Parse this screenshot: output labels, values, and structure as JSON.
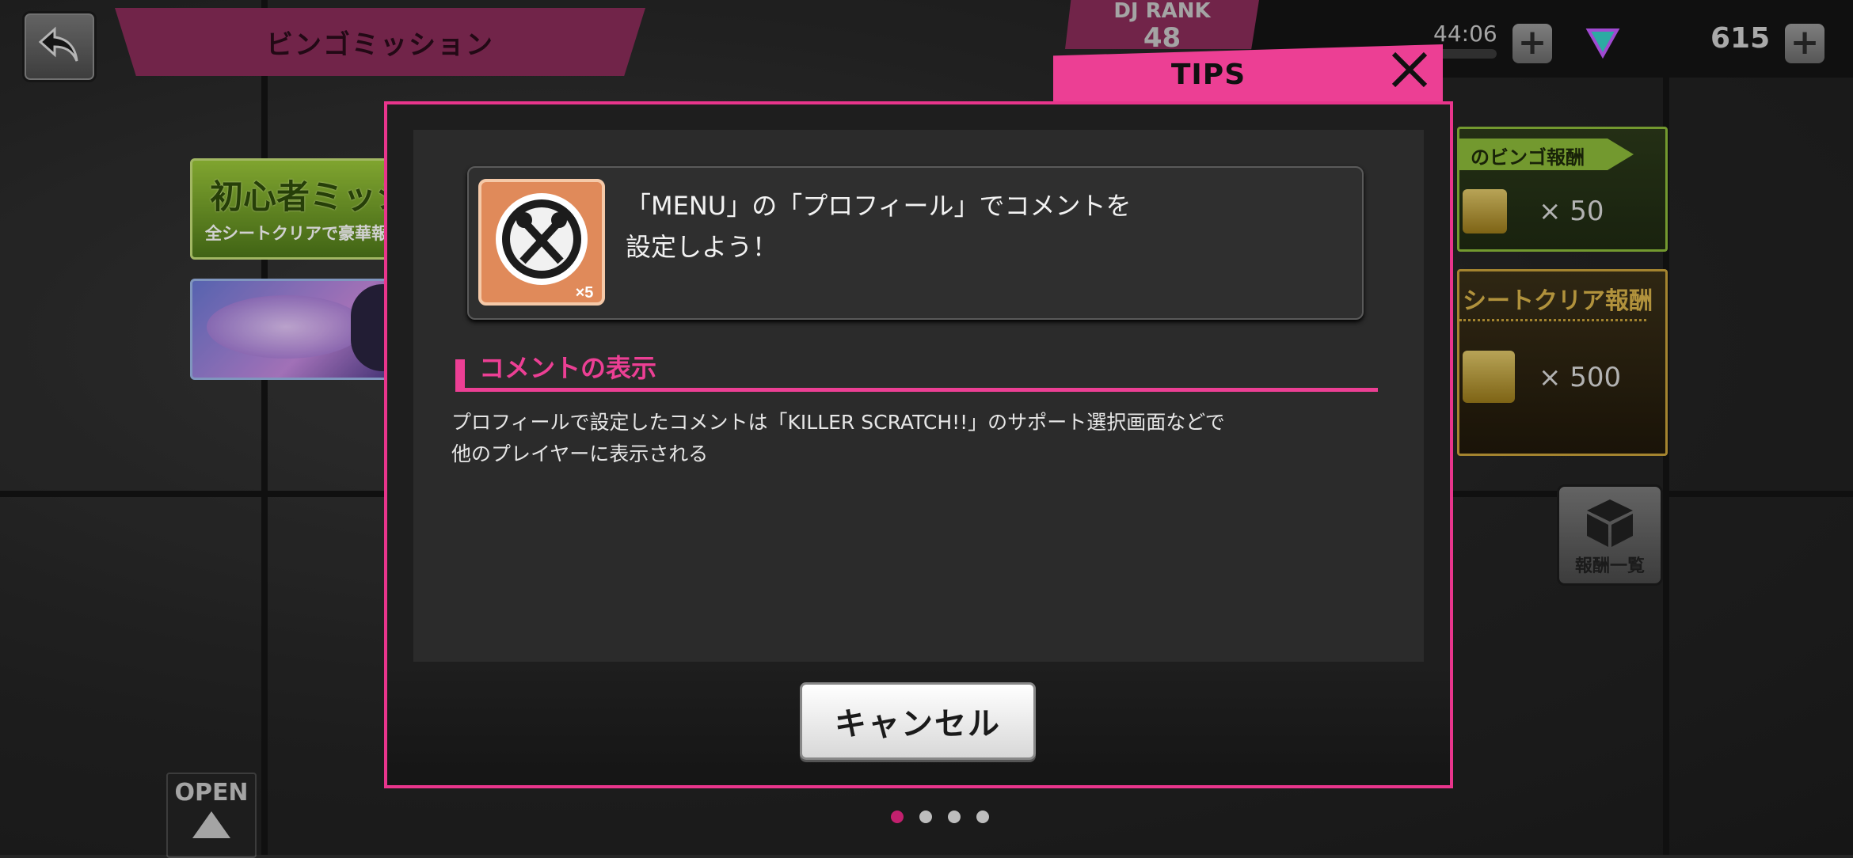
{
  "header": {
    "title": "ビンゴミッション",
    "rank_label": "DJ RANK",
    "rank_value": "48",
    "timer": "44:06",
    "gem_count": "615"
  },
  "events": {
    "beginner_title": "初心者ミッシ",
    "beginner_sub": "全シートクリアで豪華報"
  },
  "rewards": {
    "bingo_label": "のビンゴ報酬",
    "bingo_count": "× 50",
    "sheet_label": "シートクリア報酬",
    "sheet_count": "× 500",
    "list_button": "報酬一覧"
  },
  "open_button": "OPEN",
  "pager": {
    "total": 4,
    "active": 0
  },
  "tips": {
    "tab_label": "TIPS",
    "item_multiplier": "×5",
    "card_text": "「MENU」の「プロフィール」でコメントを\n設定しよう！",
    "section_title": "コメントの表示",
    "body": "プロフィールで設定したコメントは「KILLER SCRATCH!!」のサポート選択画面などで\n他のプレイヤーに表示される",
    "cancel_label": "キャンセル"
  },
  "colors": {
    "accent_pink": "#ec3f94",
    "banner_magenta": "#8a2d5a",
    "reward_green": "#8dbb3a",
    "reward_gold": "#c9a23a"
  },
  "icons": [
    "back-arrow-icon",
    "plus-icon",
    "gem-icon",
    "close-icon",
    "microphone-item-icon",
    "box-icon",
    "up-arrow-icon"
  ]
}
